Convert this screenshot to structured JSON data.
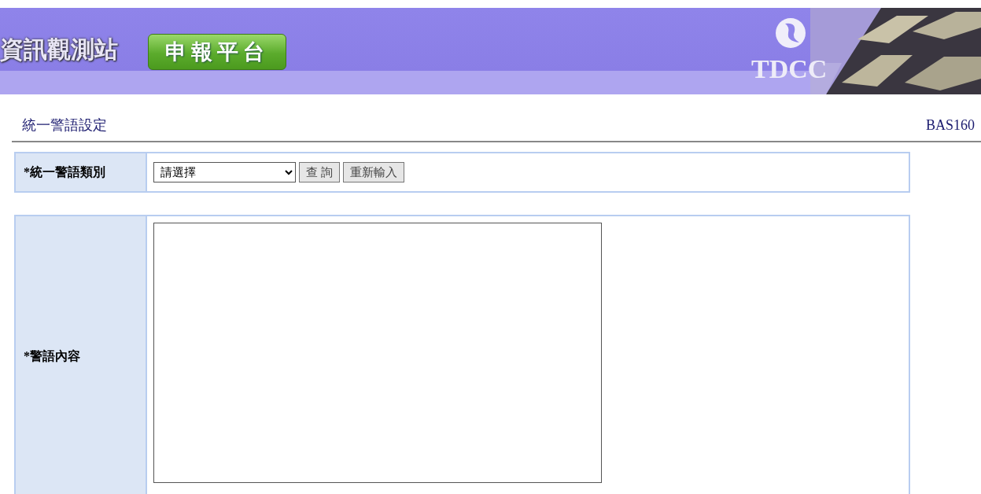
{
  "banner": {
    "site_name": "資訊觀測站",
    "platform_button": "申報平台",
    "logo_text": "TDCC"
  },
  "page": {
    "title": "統一警語設定",
    "code": "BAS160"
  },
  "form": {
    "category": {
      "label": "*統一警語類別",
      "select": {
        "value": "請選擇"
      },
      "buttons": [
        "查 詢",
        "重新輸入"
      ]
    },
    "content": {
      "label": "*警語內容"
    }
  }
}
